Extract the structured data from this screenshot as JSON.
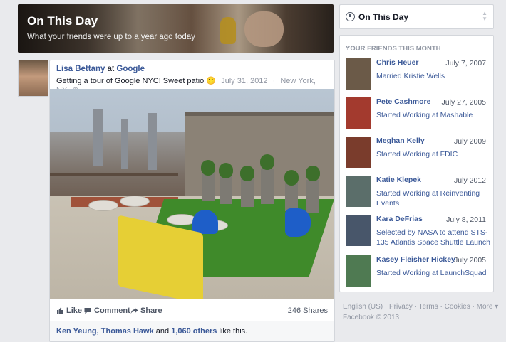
{
  "banner": {
    "title": "On This Day",
    "subtitle": "What your friends were up to a year ago today"
  },
  "post": {
    "author": "Lisa Bettany",
    "at_word": "at",
    "place": "Google",
    "text": "Getting a tour of Google NYC! Sweet patio",
    "emoji": "🙂",
    "date": "July 31, 2012",
    "location": "New York, NY",
    "actions": {
      "like": "Like",
      "comment": "Comment",
      "share": "Share"
    },
    "shares": "246 Shares",
    "likes": {
      "names": "Ken Yeung, Thomas Hawk",
      "and": "and",
      "others": "1,060 others",
      "suffix": "like this."
    }
  },
  "sidebar": {
    "selector_label": "On This Day",
    "section_title": "YOUR FRIENDS THIS MONTH",
    "friends": [
      {
        "name": "Chris Heuer",
        "date": "July 7, 2007",
        "event": "Married Kristie Wells",
        "color": "#6b5a48"
      },
      {
        "name": "Pete Cashmore",
        "date": "July 27, 2005",
        "event": "Started Working at Mashable",
        "color": "#a33a2e"
      },
      {
        "name": "Meghan Kelly",
        "date": "July 2009",
        "event": "Started Working at FDIC",
        "color": "#7a3c2c"
      },
      {
        "name": "Katie Klepek",
        "date": "July 2012",
        "event": "Started Working at Reinventing Events",
        "color": "#5b6e6a"
      },
      {
        "name": "Kara DeFrias",
        "date": "July 8, 2011",
        "event": "Selected by NASA to attend STS-135 Atlantis Space Shuttle Launch",
        "color": "#48566a"
      },
      {
        "name": "Kasey Fleisher Hickey",
        "date": "July 2005",
        "event": "Started Working at LaunchSquad",
        "color": "#4f7a52"
      }
    ]
  },
  "footer": {
    "line1": "English (US) · Privacy · Terms · Cookies · More ▾",
    "line2": "Facebook © 2013"
  }
}
